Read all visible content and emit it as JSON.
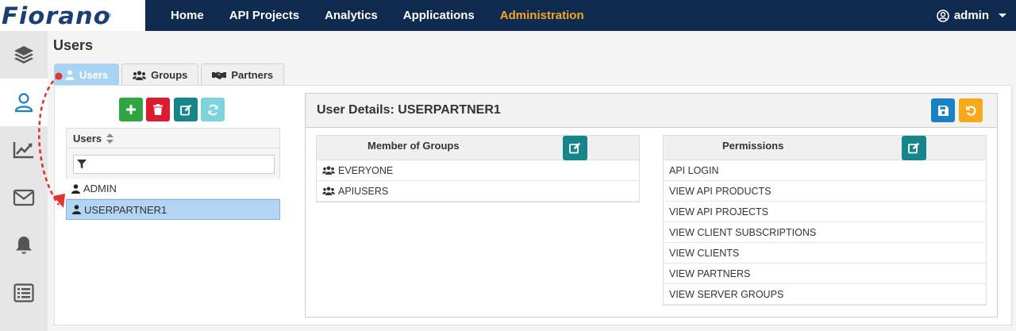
{
  "app": {
    "logo": "Fiorano",
    "logo_mark": "®"
  },
  "nav": {
    "items": [
      "Home",
      "API Projects",
      "Analytics",
      "Applications",
      "Administration"
    ],
    "active": "Administration",
    "user": "admin"
  },
  "sidebar": {
    "icons": [
      "layers-icon",
      "user-icon",
      "analytics-icon",
      "mail-icon",
      "bell-icon",
      "list-icon"
    ],
    "active": "user-icon"
  },
  "page": {
    "title": "Users"
  },
  "tabs": [
    {
      "label": "Users",
      "icon": "user-icon",
      "active": true
    },
    {
      "label": "Groups",
      "icon": "users-icon",
      "active": false
    },
    {
      "label": "Partners",
      "icon": "handshake-icon",
      "active": false
    }
  ],
  "toolbar": {
    "add": "add-icon",
    "delete": "trash-icon",
    "edit": "edit-icon",
    "refresh": "refresh-icon"
  },
  "users_list": {
    "header": "Users",
    "filter_placeholder": "",
    "rows": [
      "ADMIN",
      "USERPARTNER1"
    ],
    "selected": "USERPARTNER1"
  },
  "details": {
    "title": "User Details: USERPARTNER1",
    "groups": {
      "header": "Member of Groups",
      "rows": [
        "EVERYONE",
        "APIUSERS"
      ]
    },
    "permissions": {
      "header": "Permissions",
      "rows": [
        "API LOGIN",
        "VIEW API PRODUCTS",
        "VIEW API PROJECTS",
        "VIEW CLIENT SUBSCRIPTIONS",
        "VIEW CLIENTS",
        "VIEW PARTNERS",
        "VIEW SERVER GROUPS"
      ]
    }
  },
  "colors": {
    "nav_bg": "#0f2a4f",
    "nav_active": "#f5a623",
    "tab_active": "#a9d3f3",
    "selected_row": "#b3d4f3",
    "annotation": "#e0342c"
  }
}
